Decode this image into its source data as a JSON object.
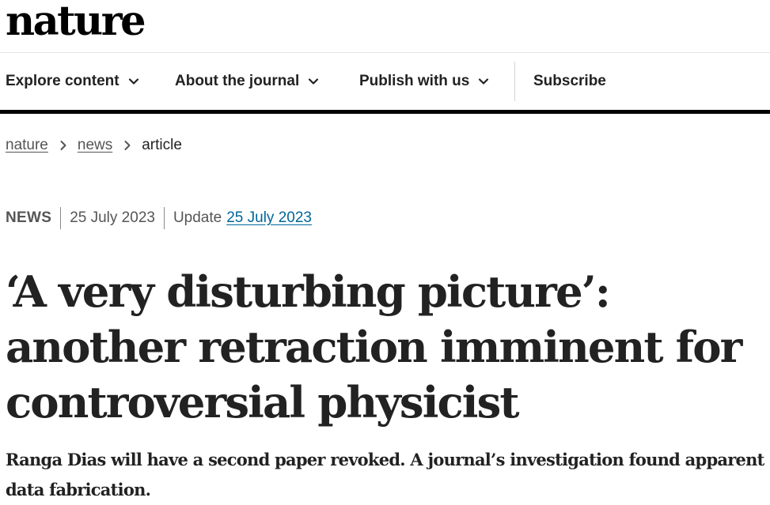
{
  "site": {
    "logo_text": "nature"
  },
  "nav": {
    "items": [
      {
        "label": "Explore content",
        "icon": "chevron-down-icon"
      },
      {
        "label": "About the journal",
        "icon": "chevron-down-icon"
      },
      {
        "label": "Publish with us",
        "icon": "chevron-down-icon"
      }
    ],
    "subscribe_label": "Subscribe"
  },
  "breadcrumb": {
    "items": [
      {
        "label": "nature",
        "link": true
      },
      {
        "label": "news",
        "link": true
      },
      {
        "label": "article",
        "link": false
      }
    ],
    "separator_icon": "chevron-right-icon"
  },
  "article": {
    "type": "NEWS",
    "published": "25 July 2023",
    "update_label": "Update",
    "update_date": "25 July 2023",
    "title": "‘A very disturbing picture’: another retraction imminent for controversial physicist",
    "standfirst": "Ranga Dias will have a second paper revoked. A journal’s investigation found apparent data fabrication."
  },
  "colors": {
    "text": "#222222",
    "muted": "#555555",
    "link": "#006699",
    "nav_rule": "#000000"
  }
}
